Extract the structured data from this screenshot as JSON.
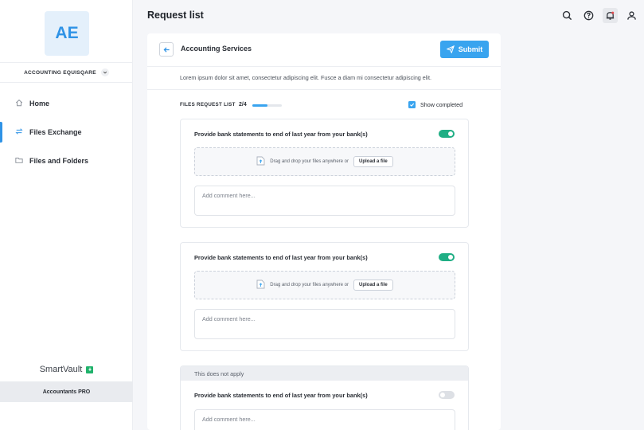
{
  "sidebar": {
    "avatar_initials": "AE",
    "company_name": "ACCOUNTING EQUISQARE",
    "nav": [
      {
        "label": "Home",
        "icon": "home-icon"
      },
      {
        "label": "Files Exchange",
        "icon": "exchange-icon",
        "active": true
      },
      {
        "label": "Files and Folders",
        "icon": "folder-icon"
      }
    ],
    "brand": "SmartVault",
    "plan": "Accountants PRO"
  },
  "header": {
    "title": "Request list",
    "icons": [
      "search-icon",
      "help-icon",
      "bell-icon",
      "user-icon"
    ]
  },
  "request": {
    "title": "Accounting Services",
    "submit_label": "Submit",
    "description": "Lorem ipsum dolor sit amet, consectetur adipiscing elit. Fusce a diam mi consectetur adipiscing elit.",
    "files_label": "FILES REQUEST LIST",
    "files_count": "2/4",
    "progress": 0.5,
    "show_completed_label": "Show completed",
    "show_completed": true
  },
  "items": [
    {
      "title": "Provide bank statements to end of last year from your bank(s)",
      "enabled": true,
      "dropzone_text": "Drag and drop your files anywhere or",
      "upload_label": "Upload a file",
      "comment_placeholder": "Add comment here..."
    },
    {
      "title": "Provide bank statements to end of last year from your bank(s)",
      "enabled": true,
      "dropzone_text": "Drag and drop your files anywhere or",
      "upload_label": "Upload a file",
      "comment_placeholder": "Add comment here..."
    },
    {
      "not_apply_label": "This does not apply",
      "title": "Provide bank statements to end of last year from your bank(s)",
      "enabled": false,
      "comment_placeholder": "Add comment here..."
    }
  ],
  "colors": {
    "accent": "#39a4ef",
    "toggle_on": "#1fae84",
    "brand_badge": "#20b26b"
  }
}
